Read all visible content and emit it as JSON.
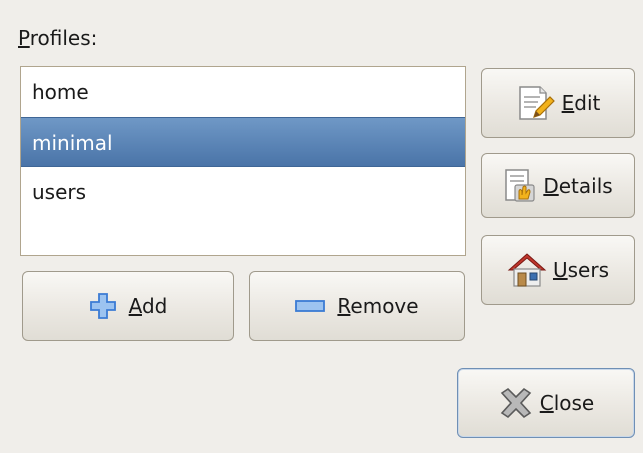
{
  "dialog": {
    "profiles_label_key": "P",
    "profiles_label_rest": "rofiles:"
  },
  "profiles": {
    "items": [
      {
        "label": "home",
        "selected": false
      },
      {
        "label": "minimal",
        "selected": true
      },
      {
        "label": "users",
        "selected": false
      }
    ]
  },
  "buttons": {
    "edit": {
      "key": "E",
      "rest": "dit",
      "icon": "edit-document-icon"
    },
    "details": {
      "key": "D",
      "rest": "etails",
      "icon": "details-document-icon"
    },
    "users": {
      "key": "U",
      "rest": "sers",
      "icon": "house-icon"
    },
    "add": {
      "key": "A",
      "rest": "dd",
      "icon": "plus-icon"
    },
    "remove": {
      "key": "R",
      "rest": "emove",
      "icon": "minus-icon"
    },
    "close": {
      "key": "C",
      "rest": "lose",
      "icon": "close-x-icon"
    }
  },
  "colors": {
    "selection": "#4a74a8",
    "plus_minus": "#3b7bd4",
    "house_roof": "#c0362c"
  }
}
